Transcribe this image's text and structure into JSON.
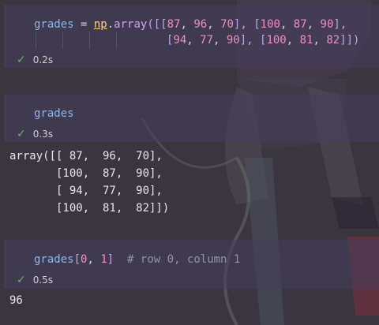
{
  "cells": [
    {
      "code_line1": {
        "var": "grades",
        "op": " = ",
        "mod": "np",
        "dot": ".",
        "func": "array",
        "rest_open": "([[",
        "n1": "87",
        "c1": ", ",
        "n2": "96",
        "c2": ", ",
        "n3": "70",
        "b1": "], [",
        "n4": "100",
        "c3": ", ",
        "n5": "87",
        "c4": ", ",
        "n6": "90",
        "b2": "],"
      },
      "code_line2": {
        "b_open": "[",
        "n1": "94",
        "c1": ", ",
        "n2": "77",
        "c2": ", ",
        "n3": "90",
        "b1": "], [",
        "n4": "100",
        "c3": ", ",
        "n5": "81",
        "c4": ", ",
        "n6": "82",
        "b_close": "]])"
      },
      "time": "0.2s"
    },
    {
      "code": "grades",
      "time": "0.3s",
      "output": [
        "array([[ 87,  96,  70],",
        "       [100,  87,  90],",
        "       [ 94,  77,  90],",
        "       [100,  81,  82]])"
      ]
    },
    {
      "code_var": "grades",
      "code_open": "[",
      "code_n1": "0",
      "code_comma": ", ",
      "code_n2": "1",
      "code_close": "]",
      "code_comment": "  # row 0, column 1",
      "time": "0.5s",
      "output": "96"
    }
  ],
  "icons": {
    "check": "checkmark-icon"
  }
}
